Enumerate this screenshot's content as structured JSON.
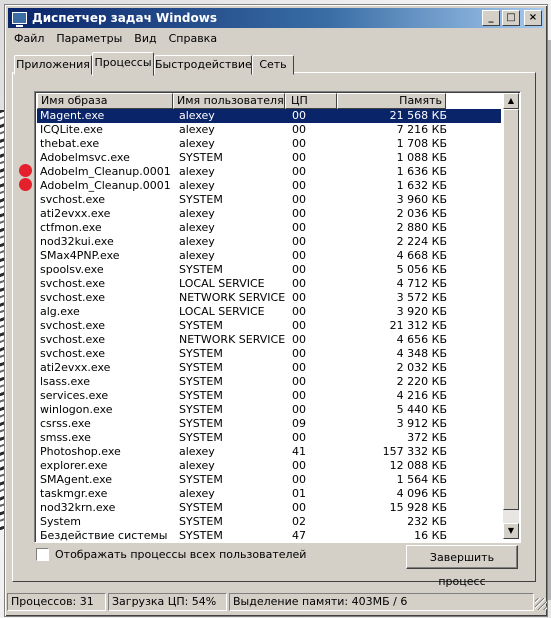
{
  "window": {
    "title": "Диспетчер задач Windows",
    "buttons": {
      "minimize": "_",
      "maximize": "□",
      "close": "×"
    }
  },
  "menu": [
    "Файл",
    "Параметры",
    "Вид",
    "Справка"
  ],
  "tabs": [
    {
      "label": "Приложения"
    },
    {
      "label": "Процессы",
      "active": true
    },
    {
      "label": "Быстродействие"
    },
    {
      "label": "Сеть"
    }
  ],
  "columns": {
    "name": "Имя образа",
    "user": "Имя пользователя",
    "cpu": "ЦП",
    "mem": "Память"
  },
  "processes": [
    {
      "name": "Magent.exe",
      "user": "alexey",
      "cpu": "00",
      "mem": "21 568 КБ",
      "selected": true
    },
    {
      "name": "ICQLite.exe",
      "user": "alexey",
      "cpu": "00",
      "mem": "7 216 КБ"
    },
    {
      "name": "thebat.exe",
      "user": "alexey",
      "cpu": "00",
      "mem": "1 708 КБ"
    },
    {
      "name": "Adobelmsvc.exe",
      "user": "SYSTEM",
      "cpu": "00",
      "mem": "1 088 КБ"
    },
    {
      "name": "Adobelm_Cleanup.0001",
      "user": "alexey",
      "cpu": "00",
      "mem": "1 636 КБ",
      "marked": true
    },
    {
      "name": "Adobelm_Cleanup.0001",
      "user": "alexey",
      "cpu": "00",
      "mem": "1 632 КБ",
      "marked": true
    },
    {
      "name": "svchost.exe",
      "user": "SYSTEM",
      "cpu": "00",
      "mem": "3 960 КБ"
    },
    {
      "name": "ati2evxx.exe",
      "user": "alexey",
      "cpu": "00",
      "mem": "2 036 КБ"
    },
    {
      "name": "ctfmon.exe",
      "user": "alexey",
      "cpu": "00",
      "mem": "2 880 КБ"
    },
    {
      "name": "nod32kui.exe",
      "user": "alexey",
      "cpu": "00",
      "mem": "2 224 КБ"
    },
    {
      "name": "SMax4PNP.exe",
      "user": "alexey",
      "cpu": "00",
      "mem": "4 668 КБ"
    },
    {
      "name": "spoolsv.exe",
      "user": "SYSTEM",
      "cpu": "00",
      "mem": "5 056 КБ"
    },
    {
      "name": "svchost.exe",
      "user": "LOCAL SERVICE",
      "cpu": "00",
      "mem": "4 712 КБ"
    },
    {
      "name": "svchost.exe",
      "user": "NETWORK SERVICE",
      "cpu": "00",
      "mem": "3 572 КБ"
    },
    {
      "name": "alg.exe",
      "user": "LOCAL SERVICE",
      "cpu": "00",
      "mem": "3 920 КБ"
    },
    {
      "name": "svchost.exe",
      "user": "SYSTEM",
      "cpu": "00",
      "mem": "21 312 КБ"
    },
    {
      "name": "svchost.exe",
      "user": "NETWORK SERVICE",
      "cpu": "00",
      "mem": "4 656 КБ"
    },
    {
      "name": "svchost.exe",
      "user": "SYSTEM",
      "cpu": "00",
      "mem": "4 348 КБ"
    },
    {
      "name": "ati2evxx.exe",
      "user": "SYSTEM",
      "cpu": "00",
      "mem": "2 032 КБ"
    },
    {
      "name": "lsass.exe",
      "user": "SYSTEM",
      "cpu": "00",
      "mem": "2 220 КБ"
    },
    {
      "name": "services.exe",
      "user": "SYSTEM",
      "cpu": "00",
      "mem": "4 216 КБ"
    },
    {
      "name": "winlogon.exe",
      "user": "SYSTEM",
      "cpu": "00",
      "mem": "5 440 КБ"
    },
    {
      "name": "csrss.exe",
      "user": "SYSTEM",
      "cpu": "09",
      "mem": "3 912 КБ"
    },
    {
      "name": "smss.exe",
      "user": "SYSTEM",
      "cpu": "00",
      "mem": "372 КБ"
    },
    {
      "name": "Photoshop.exe",
      "user": "alexey",
      "cpu": "41",
      "mem": "157 332 КБ"
    },
    {
      "name": "explorer.exe",
      "user": "alexey",
      "cpu": "00",
      "mem": "12 088 КБ"
    },
    {
      "name": "SMAgent.exe",
      "user": "SYSTEM",
      "cpu": "00",
      "mem": "1 564 КБ"
    },
    {
      "name": "taskmgr.exe",
      "user": "alexey",
      "cpu": "01",
      "mem": "4 096 КБ"
    },
    {
      "name": "nod32krn.exe",
      "user": "SYSTEM",
      "cpu": "00",
      "mem": "15 928 КБ"
    },
    {
      "name": "System",
      "user": "SYSTEM",
      "cpu": "02",
      "mem": "232 КБ"
    },
    {
      "name": "Бездействие системы",
      "user": "SYSTEM",
      "cpu": "47",
      "mem": "16 КБ"
    }
  ],
  "show_all_label": "Отображать процессы всех пользователей",
  "end_process_label": "Завершить процесс",
  "status": {
    "processes": "Процессов: 31",
    "cpu": "Загрузка ЦП: 54%",
    "memory": "Выделение памяти: 403МБ / 6"
  },
  "colors": {
    "selection": "#0a246a",
    "marker": "#e3202c",
    "title_start": "#0a246a",
    "title_end": "#a6caf0"
  }
}
